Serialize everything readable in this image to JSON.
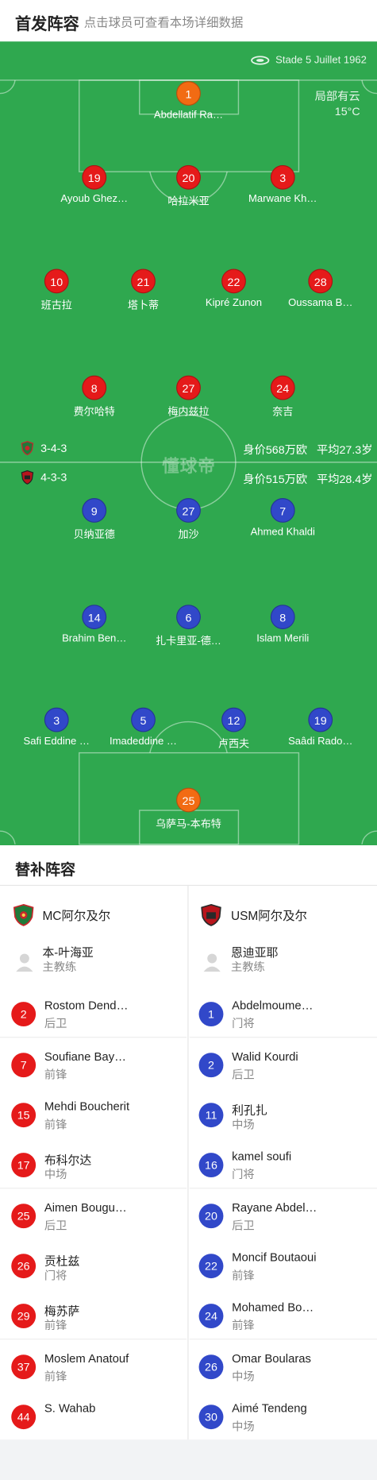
{
  "header": {
    "title": "首发阵容",
    "subtitle": "点击球员可查看本场详细数据"
  },
  "pitch": {
    "venue": "Stade 5 Juillet 1962",
    "weather": "局部有云",
    "temperature": "15°C",
    "watermark": "懂球帝",
    "home": {
      "formation": "3-4-3",
      "value": "身价568万欧",
      "avg_age": "平均27.3岁"
    },
    "away": {
      "formation": "4-3-3",
      "value": "身价515万欧",
      "avg_age": "平均28.4岁"
    },
    "home_players": [
      {
        "num": "1",
        "name": "Abdellatif Ra…",
        "color": "orange"
      },
      {
        "num": "19",
        "name": "Ayoub Ghez…",
        "color": "red"
      },
      {
        "num": "20",
        "name": "哈拉米亚",
        "color": "red"
      },
      {
        "num": "3",
        "name": "Marwane Kh…",
        "color": "red"
      },
      {
        "num": "10",
        "name": "班古拉",
        "color": "red"
      },
      {
        "num": "21",
        "name": "塔卜蒂",
        "color": "red"
      },
      {
        "num": "22",
        "name": "Kipré Zunon",
        "color": "red"
      },
      {
        "num": "28",
        "name": "Oussama B…",
        "color": "red"
      },
      {
        "num": "8",
        "name": "费尔哈特",
        "color": "red"
      },
      {
        "num": "27",
        "name": "梅内兹拉",
        "color": "red"
      },
      {
        "num": "24",
        "name": "奈吉",
        "color": "red"
      }
    ],
    "away_players": [
      {
        "num": "9",
        "name": "贝纳亚德",
        "color": "blue"
      },
      {
        "num": "27",
        "name": "加沙",
        "color": "blue"
      },
      {
        "num": "7",
        "name": "Ahmed Khaldi",
        "color": "blue"
      },
      {
        "num": "14",
        "name": "Brahim Ben…",
        "color": "blue"
      },
      {
        "num": "6",
        "name": "扎卡里亚-德…",
        "color": "blue"
      },
      {
        "num": "8",
        "name": "Islam Merili",
        "color": "blue"
      },
      {
        "num": "3",
        "name": "Safi Eddine …",
        "color": "blue"
      },
      {
        "num": "5",
        "name": "Imadeddine …",
        "color": "blue"
      },
      {
        "num": "12",
        "name": "卢西夫",
        "color": "blue"
      },
      {
        "num": "19",
        "name": "Saâdi Rado…",
        "color": "blue"
      },
      {
        "num": "25",
        "name": "乌萨马-本布特",
        "color": "orange"
      }
    ]
  },
  "subs": {
    "title": "替补阵容",
    "home_team": "MC阿尔及尔",
    "away_team": "USM阿尔及尔",
    "home_coach": {
      "name": "本-叶海亚",
      "role": "主教练"
    },
    "away_coach": {
      "name": "恩迪亚耶",
      "role": "主教练"
    },
    "home": [
      {
        "num": "2",
        "name": "Rostom Dend…",
        "pos": "后卫"
      },
      {
        "num": "7",
        "name": "Soufiane Bay…",
        "pos": "前锋"
      },
      {
        "num": "15",
        "name": "Mehdi Boucherit",
        "pos": "前锋"
      },
      {
        "num": "17",
        "name": "布科尔达",
        "pos": "中场"
      },
      {
        "num": "25",
        "name": "Aimen Bougu…",
        "pos": "后卫"
      },
      {
        "num": "26",
        "name": "贡杜兹",
        "pos": "门将"
      },
      {
        "num": "29",
        "name": "梅苏萨",
        "pos": "前锋"
      },
      {
        "num": "37",
        "name": "Moslem Anatouf",
        "pos": "前锋"
      },
      {
        "num": "44",
        "name": "S. Wahab",
        "pos": ""
      }
    ],
    "away": [
      {
        "num": "1",
        "name": "Abdelmoume…",
        "pos": "门将"
      },
      {
        "num": "2",
        "name": "Walid Kourdi",
        "pos": "后卫"
      },
      {
        "num": "11",
        "name": "利孔扎",
        "pos": "中场"
      },
      {
        "num": "16",
        "name": "kamel soufi",
        "pos": "门将"
      },
      {
        "num": "20",
        "name": "Rayane Abdel…",
        "pos": "后卫"
      },
      {
        "num": "22",
        "name": "Moncif Boutaoui",
        "pos": "前锋"
      },
      {
        "num": "24",
        "name": "Mohamed Bo…",
        "pos": "前锋"
      },
      {
        "num": "26",
        "name": "Omar Boularas",
        "pos": "中场"
      },
      {
        "num": "30",
        "name": "Aimé Tendeng",
        "pos": "中场"
      }
    ]
  },
  "colors": {
    "pitch": "#2fa84f",
    "home_badge": "#e51a1a",
    "away_badge": "#3148c9",
    "keeper": "#f26b13"
  }
}
